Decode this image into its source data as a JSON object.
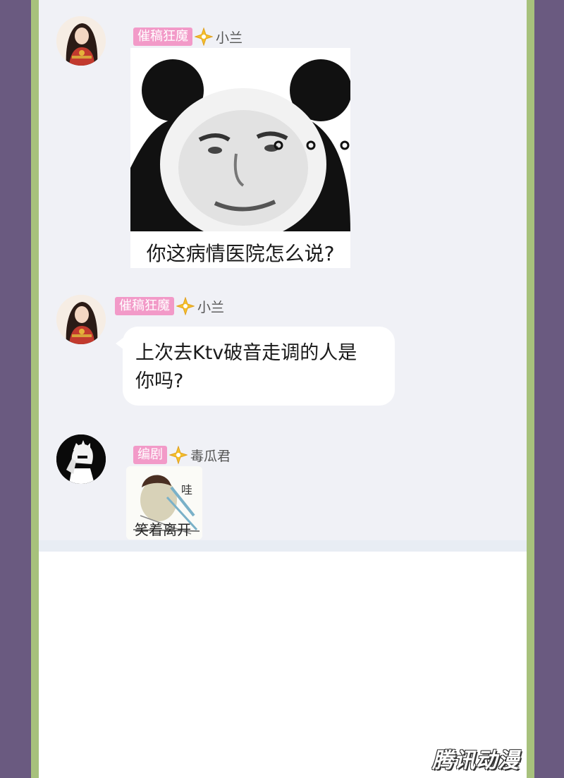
{
  "messages": [
    {
      "role_tag": "催稿狂魔",
      "username": "小兰",
      "type": "sticker",
      "sticker_caption": "你这病情医院怎么说?",
      "sticker_overlay": "o o o"
    },
    {
      "role_tag": "催稿狂魔",
      "username": "小兰",
      "type": "text",
      "text_line1": "上次去Ktv破音走调的人是",
      "text_line2": "你吗?"
    },
    {
      "role_tag": "编剧",
      "username": "毒瓜君",
      "type": "sticker",
      "sticker_caption": "笑着离开",
      "sticker_sfx": "哇"
    }
  ],
  "watermark": "腾讯动漫",
  "colors": {
    "outer_border": "#6a5a80",
    "green_frame": "#a7c17c",
    "chat_background": "#f0f1f6",
    "role_tag": "#f29ac8",
    "badge_star": "#f5c12a"
  }
}
